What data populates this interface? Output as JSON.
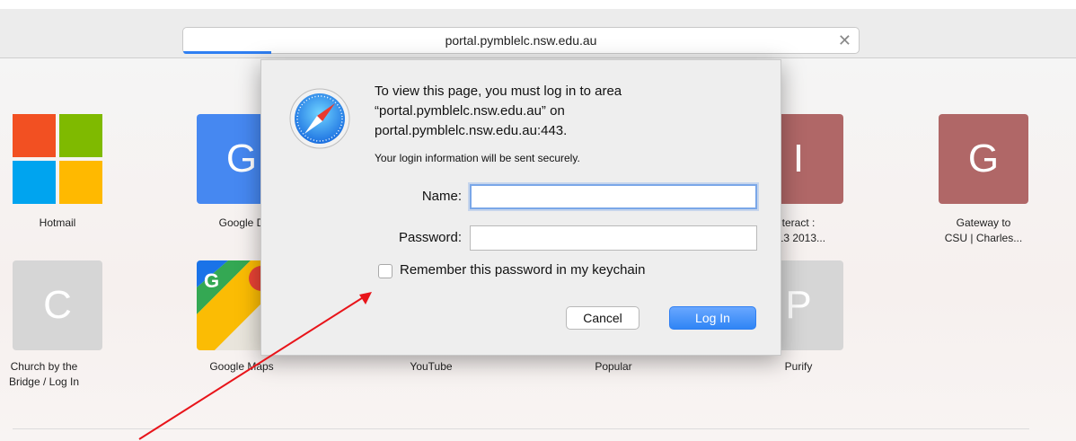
{
  "browser": {
    "url": "portal.pymblelc.nsw.edu.au",
    "load_progress": 0.13
  },
  "tiles": [
    {
      "label": "Hotmail",
      "letter": "",
      "color": "#ffffff",
      "label2": ""
    },
    {
      "label": "Google D",
      "letter": "G",
      "color": "#4688f1",
      "label2": ""
    },
    {
      "label": "teract :",
      "letter": "I",
      "color": "#b06767",
      "label2": "413 2013..."
    },
    {
      "label": "Gateway to",
      "letter": "G",
      "color": "#b06767",
      "label2": "CSU | Charles..."
    },
    {
      "label": "Church by the",
      "letter": "C",
      "color": "#d3d3d3",
      "label2": "Bridge / Log In"
    },
    {
      "label": "Google Maps",
      "letter": "G",
      "color": "#ffffff",
      "label2": ""
    },
    {
      "label": "YouTube",
      "letter": "",
      "color": "",
      "label2": ""
    },
    {
      "label": "Popular",
      "letter": "",
      "color": "",
      "label2": ""
    },
    {
      "label": "Purify",
      "letter": "P",
      "color": "#d6d6d6",
      "label2": ""
    }
  ],
  "dialog": {
    "message_line1": "To view this page, you must log in to area",
    "message_line2": "“portal.pymblelc.nsw.edu.au” on",
    "message_line3": "portal.pymblelc.nsw.edu.au:443.",
    "secure_note": "Your login information will be sent securely.",
    "name_label": "Name:",
    "name_value": "",
    "password_label": "Password:",
    "password_value": "",
    "remember_label": "Remember this password in my keychain",
    "cancel_label": "Cancel",
    "login_label": "Log In"
  },
  "annotation": {
    "color": "#e8141a"
  }
}
